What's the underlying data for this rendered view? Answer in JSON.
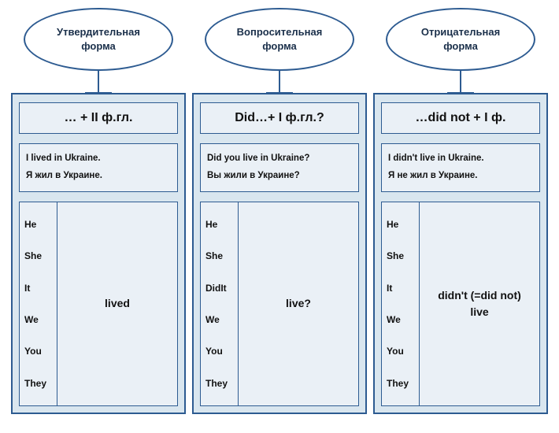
{
  "columns": [
    {
      "title": "Утвердительная\nформа",
      "formula": "… + II ф.гл.",
      "example_en": "I lived in Ukraine.",
      "example_ru": "Я жил в Украине.",
      "pronouns": [
        "He",
        "She",
        "It",
        "We",
        "You",
        "They"
      ],
      "verb": "lived"
    },
    {
      "title": "Вопросительная\nформа",
      "formula": "Did…+ I ф.гл.?",
      "example_en": "Did you live in Ukraine?",
      "example_ru": "Вы жили в Украине?",
      "pronouns": [
        "He",
        "She",
        "DidIt",
        "We",
        "You",
        "They"
      ],
      "verb": "live?"
    },
    {
      "title": "Отрицательная\nформа",
      "formula": "…did not + I ф.",
      "example_en": "I didn't live in Ukraine.",
      "example_ru": "Я не жил в Украине.",
      "pronouns": [
        "He",
        "She",
        "It",
        "We",
        "You",
        "They"
      ],
      "verb": "didn't (=did not)\nlive"
    }
  ]
}
